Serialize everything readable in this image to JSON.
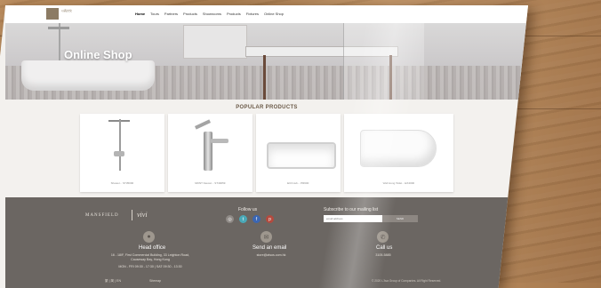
{
  "header": {
    "logo_text": "以森文化",
    "nav": [
      "Home",
      "Tours",
      "Partners",
      "Products",
      "Showrooms",
      "Products",
      "Fixtures",
      "Online Shop"
    ]
  },
  "hero": {
    "title": "Online Shop"
  },
  "products_section": {
    "title": "POPULAR PRODUCTS",
    "items": [
      {
        "caption": "Shower... ST35000",
        "kind": "shower"
      },
      {
        "caption": "MONT Faucet... ST49059",
        "kind": "faucet"
      },
      {
        "caption": "ECO-tub... PR600",
        "kind": "bathtub"
      },
      {
        "caption": "Wall Hung Toilet... EX4000",
        "kind": "toilet"
      }
    ]
  },
  "footer": {
    "brand_left": "MANSFIELD",
    "brand_right": "vivi",
    "follow_label": "Follow us",
    "socials": [
      {
        "icon": "instagram-icon",
        "color": "#8f8a86"
      },
      {
        "icon": "twitter-icon",
        "color": "#4aa9b8"
      },
      {
        "icon": "facebook-icon",
        "color": "#3b66b3"
      },
      {
        "icon": "pinterest-icon",
        "color": "#b44a3e"
      }
    ],
    "subscribe_label": "Subscribe to our mailing list",
    "subscribe_placeholder": "email address",
    "subscribe_button": "SEND",
    "head_office": {
      "title": "Head office",
      "address_line1": "16 - 18/F, First Commercial Building, 33 Leighton Road,",
      "address_line2": "Causeway Bay, Hong Kong",
      "hours": "MON - FRI 09:30 - 17:30 | SAT 09:30 - 13:30"
    },
    "email": {
      "title": "Send an email",
      "value": "store@atsos.com.hk"
    },
    "call": {
      "title": "Call us",
      "value": "3105-5885"
    },
    "lang_links": "繁 | 简 | EN",
    "sitemap": "Sitemap",
    "copyright": "© 2020 L'Ava Group of Companies. All Right Reserved."
  }
}
